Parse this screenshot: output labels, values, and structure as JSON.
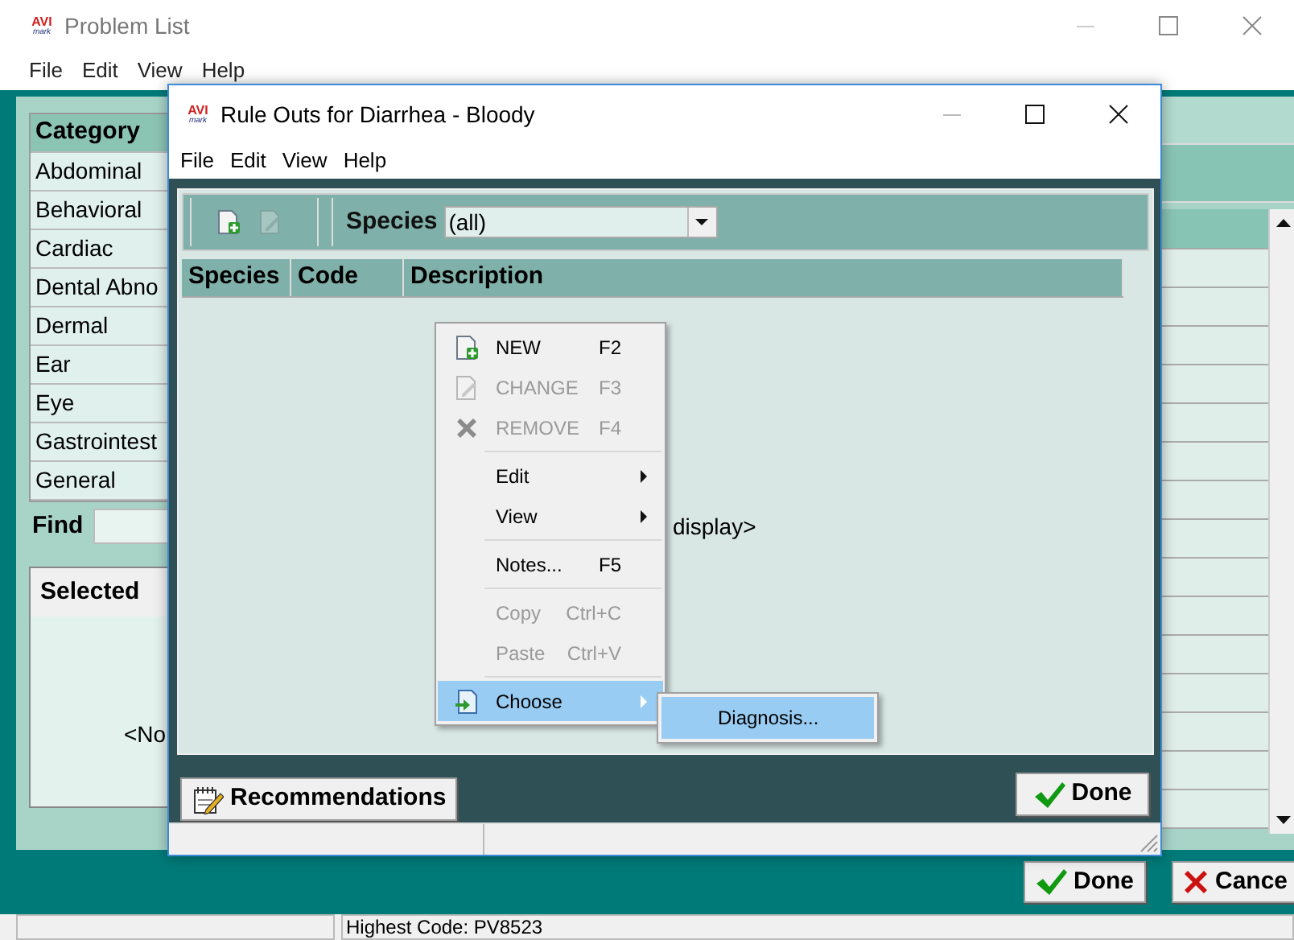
{
  "main_window": {
    "logo": {
      "top": "AVI",
      "bottom": "mark"
    },
    "title": "Problem List",
    "menu": [
      "File",
      "Edit",
      "View",
      "Help"
    ],
    "category_list": {
      "header": "Category",
      "items": [
        "Abdominal",
        "Behavioral",
        "Cardiac",
        "Dental Abno",
        "Dermal",
        "Ear",
        "Eye",
        "Gastrointest",
        "General"
      ]
    },
    "find_label": "Find",
    "selected_panel": {
      "header": "Selected",
      "empty_text": "<No"
    },
    "buttons": [
      {
        "kind": "done",
        "label": "Done"
      },
      {
        "kind": "cancel",
        "label": "Cance"
      }
    ],
    "status_bar": {
      "panel_2": "Highest Code: PV8523"
    }
  },
  "dialog": {
    "logo": {
      "top": "AVI",
      "bottom": "mark"
    },
    "title": "Rule Outs for Diarrhea - Bloody",
    "menu": [
      "File",
      "Edit",
      "View",
      "Help"
    ],
    "toolbar": [
      {
        "kind": "new",
        "disabled": false
      },
      {
        "kind": "change",
        "disabled": true
      }
    ],
    "species_filter": {
      "label": "Species",
      "value": "(all)"
    },
    "columns": [
      "Species",
      "Code",
      "Description"
    ],
    "empty_text": "display>",
    "buttons": [
      {
        "kind": "notes",
        "label": "Recommendations"
      },
      {
        "kind": "done",
        "label": "Done"
      }
    ]
  },
  "context_menu": {
    "items": [
      {
        "kind": "new",
        "label": "NEW",
        "shortcut": "F2",
        "disabled": false,
        "submenu": false,
        "selected": false
      },
      {
        "kind": "change",
        "label": "CHANGE",
        "shortcut": "F3",
        "disabled": true,
        "submenu": false,
        "selected": false
      },
      {
        "kind": "remove",
        "label": "REMOVE",
        "shortcut": "F4",
        "disabled": true,
        "submenu": false,
        "selected": false
      },
      {
        "kind": "separator"
      },
      {
        "kind": "item",
        "label": "Edit",
        "disabled": false,
        "submenu": true,
        "selected": false
      },
      {
        "kind": "item",
        "label": "View",
        "disabled": false,
        "submenu": true,
        "selected": false
      },
      {
        "kind": "separator"
      },
      {
        "kind": "item",
        "label": "Notes...",
        "shortcut": "F5",
        "disabled": false,
        "submenu": false,
        "selected": false
      },
      {
        "kind": "separator"
      },
      {
        "kind": "item",
        "label": "Copy",
        "shortcut": "Ctrl+C",
        "disabled": true,
        "submenu": false,
        "selected": false
      },
      {
        "kind": "item",
        "label": "Paste",
        "shortcut": "Ctrl+V",
        "disabled": true,
        "submenu": false,
        "selected": false
      },
      {
        "kind": "separator"
      },
      {
        "kind": "choose",
        "label": "Choose",
        "disabled": false,
        "submenu": true,
        "selected": true
      }
    ]
  },
  "submenu": {
    "items": [
      {
        "label": "Diagnosis...",
        "selected": true
      }
    ]
  }
}
